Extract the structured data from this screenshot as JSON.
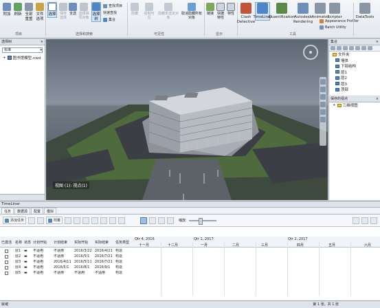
{
  "ribbon": {
    "buttons_left": [
      "附加",
      "刷新",
      "全部重置",
      "文件选项"
    ],
    "select_buttons": [
      "选择",
      "保存选择",
      "全选",
      "选择相同对象",
      "选择树"
    ],
    "find_items": [
      "查找项目",
      "快速查找",
      "集合"
    ],
    "visibility": [
      "隐藏",
      "强制可见",
      "隐藏未选定对象",
      "取消隐藏所有对象"
    ],
    "display": [
      "链接",
      "快捷特性",
      "特性"
    ],
    "tools": [
      "Clash Detective",
      "TimeLiner",
      "Quantification",
      "Autodesk Rendering",
      "Animator",
      "Scripter"
    ],
    "tools_small": [
      "Appearance Profiler",
      "Batch Utility"
    ],
    "datatools": "DataTools",
    "group_labels": [
      "项目",
      "选择和搜索",
      "可见性",
      "显示",
      "工具"
    ]
  },
  "left_panel": {
    "title": "选择树",
    "dropdown": "标准",
    "tree_item": "图书馆模型.nwd"
  },
  "viewport": {
    "label": "视图 (1): 视点(1)"
  },
  "sets_panel": {
    "title": "集合",
    "items": [
      {
        "label": "文件夹",
        "type": "folder"
      },
      {
        "label": "墙体",
        "type": "child"
      },
      {
        "label": "下部结构",
        "type": "child"
      },
      {
        "label": "层1",
        "type": "child"
      },
      {
        "label": "层2",
        "type": "child"
      },
      {
        "label": "层3",
        "type": "child"
      },
      {
        "label": "顶部",
        "type": "child"
      }
    ]
  },
  "saved_viewpoints": {
    "title": "保存的视点",
    "item": "三维视图"
  },
  "timeliner": {
    "title": "TimeLiner",
    "tabs": [
      "任务",
      "数据源",
      "配置",
      "模拟"
    ],
    "toolbar": {
      "add_task": "添加任务",
      "attach": "附着",
      "zoom_label": "缩放:"
    },
    "columns": [
      "已激活",
      "名称",
      "状态",
      "计划开始",
      "计划结束",
      "实际开始",
      "实际结束",
      "任务类型"
    ],
    "quarters": [
      "Qtr 4, 2016",
      "Qtr 1, 2017",
      "Qtr 2, 2017"
    ],
    "months": [
      "十一月",
      "十二月",
      "一月",
      "二月",
      "三月",
      "四月",
      "五月",
      "六月"
    ],
    "rows": [
      {
        "name": "层1",
        "status": "",
        "plan_start": "不适用",
        "plan_end": "不适用",
        "actual_start": "2016/3/22",
        "actual_end": "2016/4/21",
        "type": "构造"
      },
      {
        "name": "层2",
        "status": "",
        "plan_start": "不适用",
        "plan_end": "不适用",
        "actual_start": "2016/5/1",
        "actual_end": "2016/7/21",
        "type": "构造"
      },
      {
        "name": "层3",
        "status": "",
        "plan_start": "不适用",
        "plan_end": "2016/4/11",
        "actual_start": "2016/5/11",
        "actual_end": "2016/7/21",
        "type": "构造"
      },
      {
        "name": "层4",
        "status": "",
        "plan_start": "不适用",
        "plan_end": "2016/5/1",
        "actual_start": "2016/8/1",
        "actual_end": "2016/9/1",
        "type": "构造"
      },
      {
        "name": "层5",
        "status": "",
        "plan_start": "不适用",
        "plan_end": "不适用",
        "actual_start": "不适用",
        "actual_end": "不适用",
        "type": "构造"
      }
    ]
  },
  "status_bar": {
    "left": "就绪",
    "right": "第 1 张，共 1 张"
  }
}
